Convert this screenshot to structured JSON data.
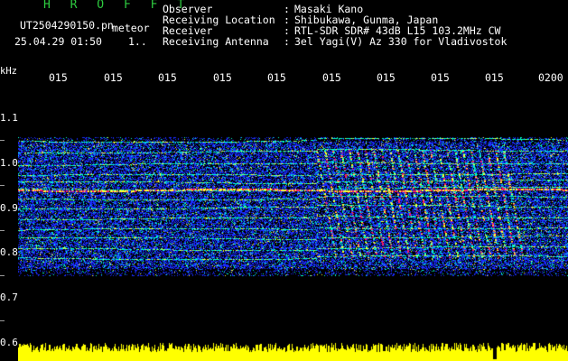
{
  "header": {
    "brand": "H R O F F T",
    "filename": "UT2504290150.pn",
    "filename_suffix": "meteor",
    "datetime": "25.04.29 01:50",
    "datetime_extra": "1..",
    "info": [
      {
        "label": "Observer",
        "sep": ":",
        "value": "Masaki Kano"
      },
      {
        "label": "Receiving Location",
        "sep": ":",
        "value": "Shibukawa, Gunma, Japan"
      },
      {
        "label": "Receiver",
        "sep": ":",
        "value": "RTL-SDR SDR# 43dB L15 103.2MHz CW"
      },
      {
        "label": "Receiving Antenna",
        "sep": ":",
        "value": "3el Yagi(V) Az 330 for Vladivostok"
      }
    ]
  },
  "axes": {
    "y_unit": "kHz",
    "x_ticks": [
      "015",
      "015",
      "015",
      "015",
      "015",
      "015",
      "015",
      "015",
      "015",
      "0200"
    ],
    "y_ticks": [
      "1.1",
      "1.0",
      "0.9",
      "0.8",
      "0.7",
      "0.6"
    ]
  },
  "colors": {
    "brand": "#2ecc40",
    "text": "#ffffff",
    "background": "#000000",
    "noise": "#1a2bff",
    "signal_mid": "#00ffcc",
    "signal_high": "#ffff33",
    "meteor": "#ff1a66",
    "amplitude": "#ffff00"
  }
}
